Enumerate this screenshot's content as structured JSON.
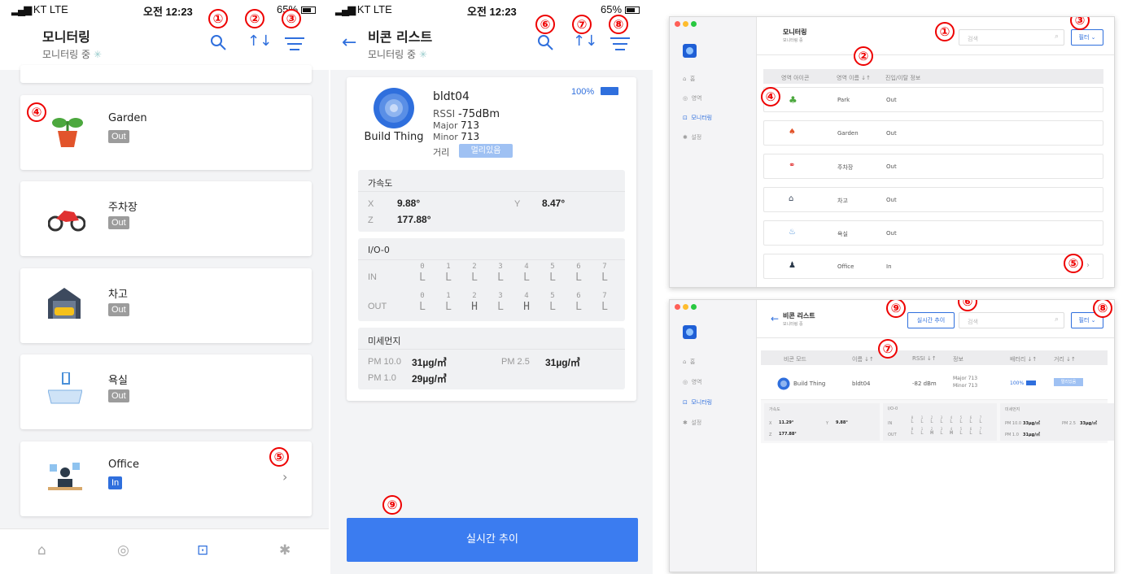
{
  "phone1": {
    "status": {
      "carrier": "KT",
      "network": "LTE",
      "time": "오전 12:23",
      "battery": "65%"
    },
    "title": "모니터링",
    "subtitle": "모니터링 중",
    "rows": [
      {
        "name": "Garden",
        "state": "Out",
        "icon": "plant-icon"
      },
      {
        "name": "주차장",
        "state": "Out",
        "icon": "motorcycle-icon"
      },
      {
        "name": "차고",
        "state": "Out",
        "icon": "garage-icon"
      },
      {
        "name": "욕실",
        "state": "Out",
        "icon": "bathtub-icon"
      },
      {
        "name": "Office",
        "state": "In",
        "icon": "office-icon"
      }
    ],
    "tabs": [
      "home-icon",
      "beacon-icon",
      "monitoring-icon",
      "settings-icon"
    ]
  },
  "phone2": {
    "status": {
      "carrier": "KT",
      "network": "LTE",
      "time": "오전 12:23",
      "battery": "65%"
    },
    "title": "비콘 리스트",
    "subtitle": "모니터링 중",
    "beacon": {
      "name": "bldt04",
      "brand": "Build Thing",
      "battery": "100%",
      "rssi_label": "RSSI",
      "rssi": "-75dBm",
      "major_label": "Major",
      "major": "713",
      "minor_label": "Minor",
      "minor": "713",
      "distance_label": "거리",
      "distance": "멀리있음"
    },
    "accel": {
      "title": "가속도",
      "x_label": "X",
      "x": "9.88°",
      "y_label": "Y",
      "y": "8.47°",
      "z_label": "Z",
      "z": "177.88°"
    },
    "io": {
      "title": "I/O-0",
      "in_label": "IN",
      "out_label": "OUT",
      "idx": [
        "0",
        "1",
        "2",
        "3",
        "4",
        "5",
        "6",
        "7"
      ],
      "in": [
        "L",
        "L",
        "L",
        "L",
        "L",
        "L",
        "L",
        "L"
      ],
      "out": [
        "L",
        "L",
        "H",
        "L",
        "H",
        "L",
        "L",
        "L"
      ]
    },
    "dust": {
      "title": "미세먼지",
      "pm10_label": "PM 10.0",
      "pm10": "31µg/㎥",
      "pm25_label": "PM 2.5",
      "pm25": "31µg/㎥",
      "pm1_label": "PM 1.0",
      "pm1": "29µg/㎥"
    },
    "button": "실시간 추이"
  },
  "mac1": {
    "title": "모니터링",
    "subtitle": "모니터링 중",
    "search_placeholder": "검색",
    "filter": "필터",
    "nav": [
      "홈",
      "영역",
      "모니터링",
      "설정"
    ],
    "headers": [
      "영역 아이콘",
      "영역 이름 ↓↑",
      "진입/이탈 정보"
    ],
    "rows": [
      {
        "name": "Park",
        "state": "Out"
      },
      {
        "name": "Garden",
        "state": "Out"
      },
      {
        "name": "주차장",
        "state": "Out"
      },
      {
        "name": "차고",
        "state": "Out"
      },
      {
        "name": "욕실",
        "state": "Out"
      },
      {
        "name": "Office",
        "state": "In"
      }
    ]
  },
  "mac2": {
    "title": "비콘 리스트",
    "subtitle": "모니터링 중",
    "button": "실시간 추이",
    "search_placeholder": "검색",
    "filter": "필터",
    "nav": [
      "홈",
      "영역",
      "모니터링",
      "설정"
    ],
    "headers": [
      "비콘 모드",
      "이름 ↓↑",
      "RSSI ↓↑",
      "정보",
      "배터리 ↓↑",
      "거리 ↓↑"
    ],
    "row": {
      "brand": "Build Thing",
      "name": "bldt04",
      "rssi": "-82 dBm",
      "major": "Major  713",
      "minor": "Minor  713",
      "battery": "100%",
      "distance": "멀리있음"
    },
    "accel": {
      "title": "가속도",
      "x_label": "X",
      "x": "11.29°",
      "y_label": "Y",
      "y": "9.88°",
      "z_label": "Z",
      "z": "177.88°"
    },
    "io": {
      "title": "I/O-0",
      "in_label": "IN",
      "out_label": "OUT"
    },
    "dust": {
      "title": "미세먼지",
      "pm10_label": "PM 10.0",
      "pm10": "33µg/㎥",
      "pm25_label": "PM 2.5",
      "pm25": "33µg/㎥",
      "pm1_label": "PM 1.0",
      "pm1": "31µg/㎥"
    }
  },
  "markers": [
    "①",
    "②",
    "③",
    "④",
    "⑤",
    "⑥",
    "⑦",
    "⑧",
    "⑨"
  ],
  "colors": {
    "accent": "#2f6fdd",
    "button": "#3b7cf0",
    "marker": "#e00000",
    "badge_gray": "#9c9c9c"
  }
}
